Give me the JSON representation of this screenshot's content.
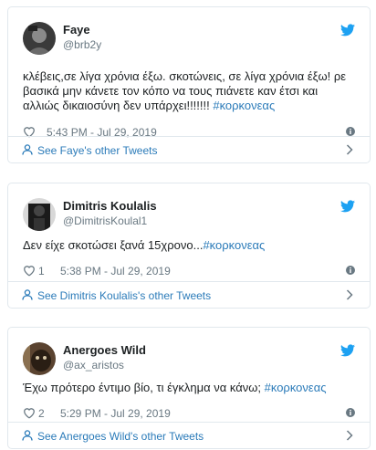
{
  "colors": {
    "link": "#2b7bb9",
    "muted": "#697882",
    "text": "#1c2022",
    "border": "#e1e8ed",
    "twitter_blue": "#1da1f2"
  },
  "tweets": [
    {
      "name": "Faye",
      "handle": "@brb2y",
      "text": "κλέβεις,σε λίγα χρόνια έξω. σκοτώνεις, σε λίγα χρόνια έξω! ρε βασικά μην κάνετε τον κόπο να τους πιάνετε καν έτσι και αλλιώς δικαιοσύνη δεν υπάρχει!!!!!!! ",
      "hashtag": "#κορκονεας",
      "likes": "",
      "time": "5:43 PM - Jul 29, 2019",
      "footer": "See Faye's other Tweets"
    },
    {
      "name": "Dimitris Koulalis",
      "handle": "@DimitrisKoulal1",
      "text": "Δεν είχε σκοτώσει ξανά 15χρονο...",
      "hashtag": "#κορκονεας",
      "likes": "1",
      "time": "5:38 PM - Jul 29, 2019",
      "footer": "See Dimitris Koulalis's other Tweets"
    },
    {
      "name": "Anergoes Wild",
      "handle": "@ax_aristos",
      "text": "Έχω πρότερο έντιμο βίο, τι έγκλημα να κάνω; ",
      "hashtag": "#κορκονεας",
      "likes": "2",
      "time": "5:29 PM - Jul 29, 2019",
      "footer": "See Anergoes Wild's other Tweets"
    }
  ]
}
